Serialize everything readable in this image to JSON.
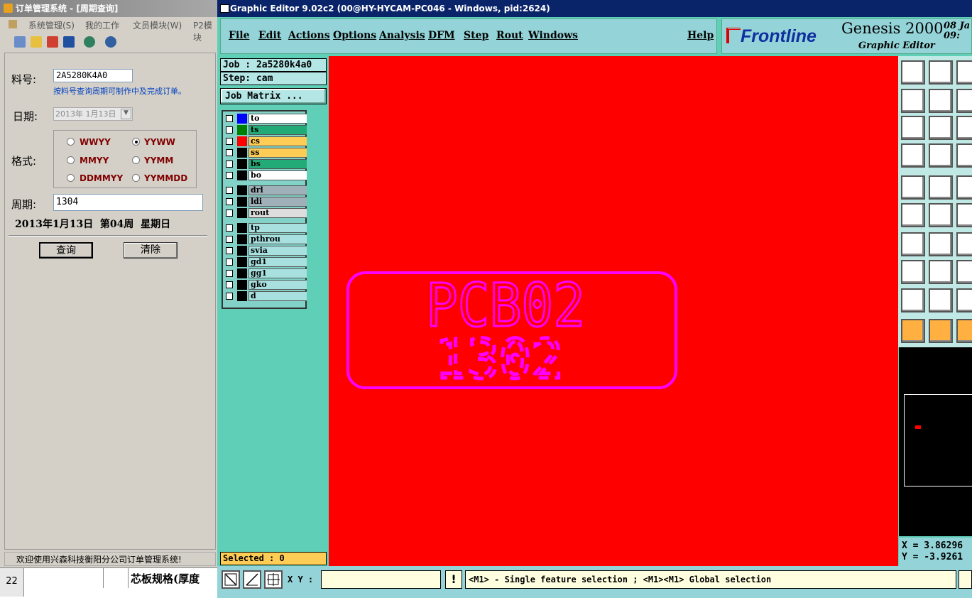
{
  "left_window": {
    "title": "订单管理系统 - [周期查询]",
    "menu": [
      "系统管理(S)",
      "我的工作",
      "文员模块(W)",
      "P2模块"
    ],
    "form": {
      "part_label": "料号:",
      "part_value": "2A5280K4A0",
      "hint": "按料号查询周期可制作中及完成订单。",
      "date_label": "日期:",
      "date_value": "2013年 1月13日",
      "format_label": "格式:",
      "formats": [
        "WWYY",
        "YYWW",
        "MMYY",
        "YYMM",
        "DDMMYY",
        "YYMMDD"
      ],
      "selected_format": "YYWW",
      "period_label": "周期:",
      "period_value": "1304",
      "result_text": "2013年1月13日  第04周  星期日",
      "query_button": "查询",
      "clear_button": "清除"
    },
    "status": "欢迎使用兴森科技衡阳分公司订单管理系统!",
    "sheet": {
      "row_num": "22",
      "cell_text": "芯板规格(厚度"
    }
  },
  "right_window": {
    "title": "Graphic Editor 9.02c2 (00@HY-HYCAM-PC046 - Windows, pid:2624)",
    "menu": [
      "File",
      "Edit",
      "Actions",
      "Options",
      "Analysis",
      "DFM",
      "Step",
      "Rout",
      "Windows"
    ],
    "help": "Help",
    "brand": {
      "logo": "Frontline",
      "product": "Genesis 2000",
      "subtitle": "Graphic Editor",
      "date": "08 Ja",
      "time": "09:"
    },
    "job": "Job : 2a5280k4a0",
    "step": "Step: cam",
    "job_matrix": "Job Matrix ...",
    "layers": [
      {
        "name": "to",
        "color": "#0000ff",
        "bg": "#ffffff"
      },
      {
        "name": "ts",
        "color": "#008000",
        "bg": "#22aa77"
      },
      {
        "name": "cs",
        "color": "#ff0000",
        "bg": "#ffcc55"
      },
      {
        "name": "ss",
        "color": "#000000",
        "bg": "#ffcc55"
      },
      {
        "name": "bs",
        "color": "#000000",
        "bg": "#22aa77"
      },
      {
        "name": "bo",
        "color": "#000000",
        "bg": "#ffffff"
      },
      {
        "name": "drl",
        "color": "#000000",
        "bg": "#a0b0b8"
      },
      {
        "name": "ldi",
        "color": "#000000",
        "bg": "#a0b0b8"
      },
      {
        "name": "rout",
        "color": "#000000",
        "bg": "#dddddd"
      },
      {
        "name": "tp",
        "color": "#000000",
        "bg": "#a8e0e0"
      },
      {
        "name": "pthrou",
        "color": "#000000",
        "bg": "#a8e0e0"
      },
      {
        "name": "svia",
        "color": "#000000",
        "bg": "#a8e0e0"
      },
      {
        "name": "gd1",
        "color": "#000000",
        "bg": "#a8e0e0"
      },
      {
        "name": "gg1",
        "color": "#000000",
        "bg": "#a8e0e0"
      },
      {
        "name": "gko",
        "color": "#000000",
        "bg": "#a8e0e0"
      },
      {
        "name": "d",
        "color": "#000000",
        "bg": "#a8e0e0"
      }
    ],
    "canvas_text_1": "PCB02",
    "canvas_text_2": "1302",
    "selected": "Selected : 0",
    "xy_label": "X Y :",
    "message": "<M1> - Single feature selection ; <M1><M1> Global selection",
    "coord_x": "X = 3.86296",
    "coord_y": "Y = -3.9261",
    "accent": "#ff00ff"
  }
}
